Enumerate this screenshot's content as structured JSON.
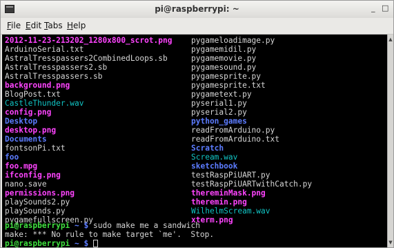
{
  "window": {
    "title": "pi@raspberrypi: ~",
    "controls": "_ □ x"
  },
  "menu": {
    "items": [
      {
        "label": "File",
        "mnemonic": "F",
        "rest": "ile"
      },
      {
        "label": "Edit",
        "mnemonic": "E",
        "rest": "dit"
      },
      {
        "label": "Tabs",
        "mnemonic": "T",
        "rest": "abs"
      },
      {
        "label": "Help",
        "mnemonic": "H",
        "rest": "elp"
      }
    ]
  },
  "colors": {
    "image_file": "#ff44ff",
    "directory": "#5c7cff",
    "audio_file": "#11c4c4",
    "plain_file": "#d6d6d6",
    "prompt_user": "#3fe03f",
    "background": "#000000"
  },
  "listing": {
    "left": [
      {
        "name": "2012-11-23-213202_1280x800_scrot.png",
        "kind": "image"
      },
      {
        "name": "ArduinoSerial.txt",
        "kind": "plain"
      },
      {
        "name": "AstralTresspassers2CombinedLoops.sb",
        "kind": "plain"
      },
      {
        "name": "AstralTresspassers2.sb",
        "kind": "plain"
      },
      {
        "name": "AstralTresspassers.sb",
        "kind": "plain"
      },
      {
        "name": "background.png",
        "kind": "image"
      },
      {
        "name": "BlogPost.txt",
        "kind": "plain"
      },
      {
        "name": "CastleThunder.wav",
        "kind": "audio"
      },
      {
        "name": "config.png",
        "kind": "image"
      },
      {
        "name": "Desktop",
        "kind": "dir"
      },
      {
        "name": "desktop.png",
        "kind": "image"
      },
      {
        "name": "Documents",
        "kind": "dir"
      },
      {
        "name": "fontsonPi.txt",
        "kind": "plain"
      },
      {
        "name": "foo",
        "kind": "dir"
      },
      {
        "name": "foo.mpg",
        "kind": "image"
      },
      {
        "name": "ifconfig.png",
        "kind": "image"
      },
      {
        "name": "nano.save",
        "kind": "plain"
      },
      {
        "name": "permissions.png",
        "kind": "image"
      },
      {
        "name": "playSounds2.py",
        "kind": "plain"
      },
      {
        "name": "playSounds.py",
        "kind": "plain"
      },
      {
        "name": "pygamefullscreen.py",
        "kind": "plain"
      }
    ],
    "right": [
      {
        "name": "pygameloadimage.py",
        "kind": "plain"
      },
      {
        "name": "pygamemidil.py",
        "kind": "plain"
      },
      {
        "name": "pygamemovie.py",
        "kind": "plain"
      },
      {
        "name": "pygamesound.py",
        "kind": "plain"
      },
      {
        "name": "pygamesprite.py",
        "kind": "plain"
      },
      {
        "name": "pygamesprite.txt",
        "kind": "plain"
      },
      {
        "name": "pygametext.py",
        "kind": "plain"
      },
      {
        "name": "pyserial1.py",
        "kind": "plain"
      },
      {
        "name": "pyserial2.py",
        "kind": "plain"
      },
      {
        "name": "python_games",
        "kind": "dir"
      },
      {
        "name": "readFromArduino.py",
        "kind": "plain"
      },
      {
        "name": "readFromArduino.txt",
        "kind": "plain"
      },
      {
        "name": "Scratch",
        "kind": "dir"
      },
      {
        "name": "Scream.wav",
        "kind": "audio"
      },
      {
        "name": "sketchbook",
        "kind": "dir"
      },
      {
        "name": "testRaspPiUART.py",
        "kind": "plain"
      },
      {
        "name": "testRaspPiUARTwithCatch.py",
        "kind": "plain"
      },
      {
        "name": "thereminMask.png",
        "kind": "image"
      },
      {
        "name": "theremin.png",
        "kind": "image"
      },
      {
        "name": "WilhelmScream.wav",
        "kind": "audio"
      },
      {
        "name": "xterm.png",
        "kind": "image"
      }
    ]
  },
  "session": {
    "prompt_user": "pi@raspberrypi",
    "prompt_path": "~ $",
    "command": "sudo make me a sandwich",
    "output": "make: *** No rule to make target `me'.  Stop.",
    "prompt2_user": "pi@raspberrypi",
    "prompt2_path": "~ $"
  }
}
